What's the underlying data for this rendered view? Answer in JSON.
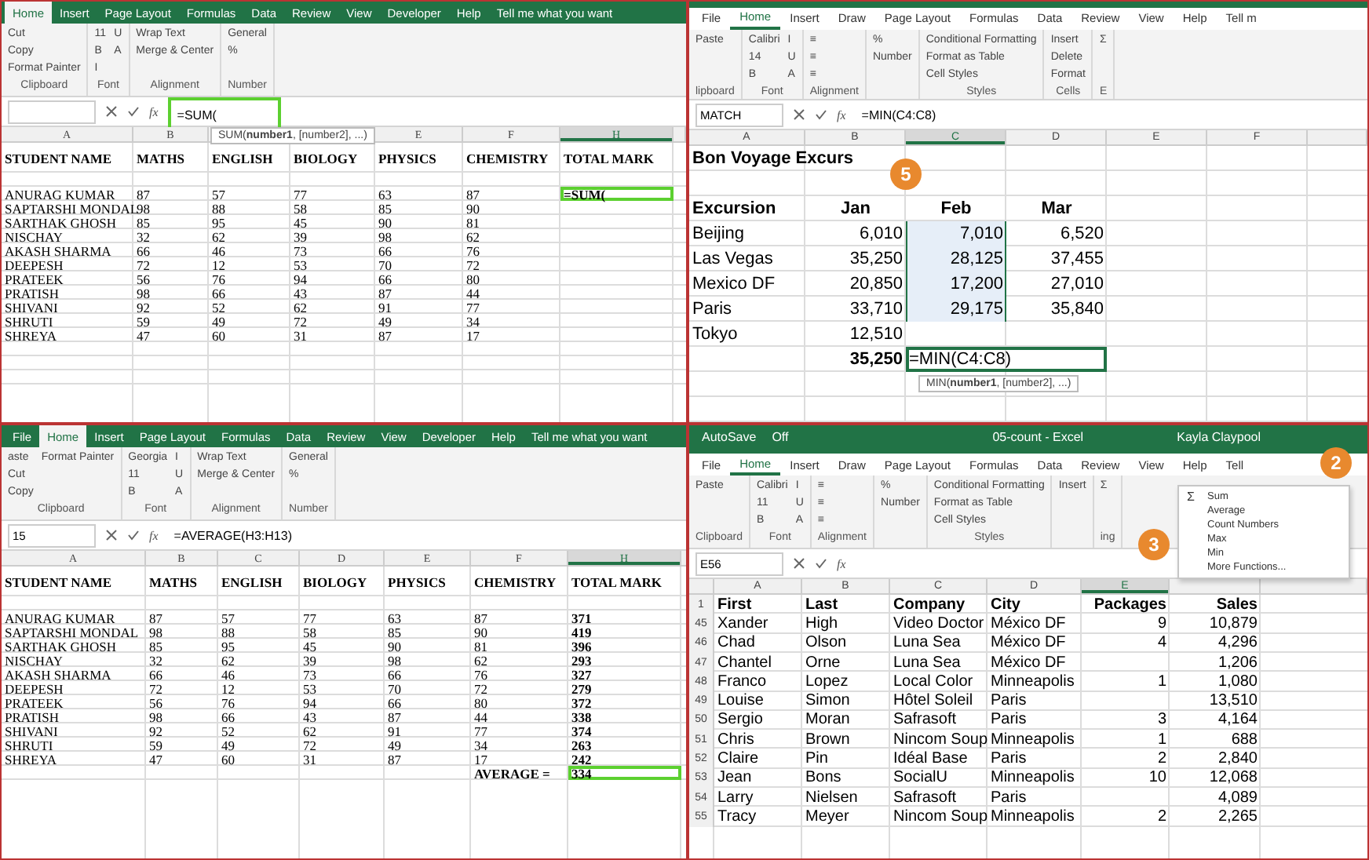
{
  "panels": [
    {
      "tabs": [
        {
          "label": "Home",
          "selected": true
        },
        {
          "label": "Insert",
          "selected": false
        },
        {
          "label": "Page Layout",
          "selected": false
        },
        {
          "label": "Formulas",
          "selected": false
        },
        {
          "label": "Data",
          "selected": false
        },
        {
          "label": "Review",
          "selected": false
        },
        {
          "label": "View",
          "selected": false
        },
        {
          "label": "Developer",
          "selected": false
        },
        {
          "label": "Help",
          "selected": false
        },
        {
          "label": "Tell me what you want",
          "selected": false
        }
      ],
      "ribbon": [
        {
          "label": "Clipboard",
          "items": [
            "Cut",
            "Copy",
            "Format Painter"
          ]
        },
        {
          "label": "Font",
          "items": [
            "11",
            "B",
            "I",
            "U",
            "A"
          ]
        },
        {
          "label": "Alignment",
          "items": [
            "Wrap Text",
            "Merge & Center"
          ]
        },
        {
          "label": "Number",
          "items": [
            "General",
            "%"
          ]
        }
      ],
      "fx": "fx",
      "formula": "=SUM(",
      "formula_outlined": true,
      "tooltip": "SUM(**number1**, [number2], ...)",
      "columns": [
        {
          "label": "A",
          "selected": false
        },
        {
          "label": "B",
          "selected": false
        },
        null,
        null,
        {
          "label": "E",
          "selected": false
        },
        {
          "label": "F",
          "selected": false
        },
        {
          "label": "H",
          "selected": true
        }
      ],
      "rows": [
        {
          "kind": "header",
          "cells": [
            "STUDENT NAME",
            "MATHS",
            "ENGLISH",
            "BIOLOGY",
            "PHYSICS",
            "CHEMISTRY",
            "TOTAL MARK"
          ]
        },
        {
          "kind": "blank"
        },
        {
          "kind": "data",
          "cells": [
            "ANURAG KUMAR",
            "87",
            "57",
            "77",
            "63",
            "87",
            {
              "text": "=SUM(",
              "selected": true,
              "kind": "label"
            }
          ]
        },
        {
          "kind": "data",
          "cells": [
            "SAPTARSHI MONDAL",
            "98",
            "88",
            "58",
            "85",
            "90"
          ]
        },
        {
          "kind": "data",
          "cells": [
            "SARTHAK GHOSH",
            "85",
            "95",
            "45",
            "90",
            "81"
          ]
        },
        {
          "kind": "data",
          "cells": [
            "NISCHAY",
            "32",
            "62",
            "39",
            "98",
            "62"
          ]
        },
        {
          "kind": "data",
          "cells": [
            "AKASH SHARMA",
            "66",
            "46",
            "73",
            "66",
            "76"
          ]
        },
        {
          "kind": "data",
          "cells": [
            "DEEPESH",
            "72",
            "12",
            "53",
            "70",
            "72"
          ]
        },
        {
          "kind": "data",
          "cells": [
            "PRATEEK",
            "56",
            "76",
            "94",
            "66",
            "80"
          ]
        },
        {
          "kind": "data",
          "cells": [
            "PRATISH",
            "98",
            "66",
            "43",
            "87",
            "44"
          ]
        },
        {
          "kind": "data",
          "cells": [
            "SHIVANI",
            "92",
            "52",
            "62",
            "91",
            "77"
          ]
        },
        {
          "kind": "data",
          "cells": [
            "SHRUTI",
            "59",
            "49",
            "72",
            "49",
            "34"
          ]
        },
        {
          "kind": "data",
          "cells": [
            "SHREYA",
            "47",
            "60",
            "31",
            "87",
            "17"
          ]
        }
      ]
    },
    {
      "tabs": [
        {
          "label": "File",
          "selected": false
        },
        {
          "label": "Home",
          "selected": true
        },
        {
          "label": "Insert",
          "selected": false
        },
        {
          "label": "Draw",
          "selected": false
        },
        {
          "label": "Page Layout",
          "selected": false
        },
        {
          "label": "Formulas",
          "selected": false
        },
        {
          "label": "Data",
          "selected": false
        },
        {
          "label": "Review",
          "selected": false
        },
        {
          "label": "View",
          "selected": false
        },
        {
          "label": "Help",
          "selected": false
        },
        {
          "label": "Tell m",
          "selected": false
        }
      ],
      "ribbon": [
        {
          "label": "lipboard",
          "items": [
            "Paste"
          ]
        },
        {
          "label": "Font",
          "items": [
            "Calibri",
            "14",
            "B",
            "I",
            "U",
            "A"
          ]
        },
        {
          "label": "Alignment",
          "items": [
            "≡",
            "≡",
            "≡"
          ]
        },
        {
          "items": [
            "%",
            "Number"
          ]
        },
        {
          "label": "Styles",
          "items": [
            "Conditional Formatting",
            "Format as Table",
            "Cell Styles"
          ]
        },
        {
          "label": "Cells",
          "items": [
            "Insert",
            "Delete",
            "Format"
          ]
        },
        {
          "label": "E",
          "items": [
            "Σ"
          ]
        }
      ],
      "name_box": "MATCH",
      "fx": "fx",
      "formula": "=MIN(C4:C8)",
      "formula_outlined": false,
      "tooltip": "MIN(**number1**, [number2], ...)",
      "callouts": [
        {
          "label": "5"
        }
      ],
      "columns": [
        {
          "label": "A",
          "selected": false
        },
        {
          "label": "B",
          "selected": false
        },
        {
          "label": "C",
          "selected": true
        },
        {
          "label": "D",
          "selected": false
        },
        {
          "label": "E",
          "selected": false
        },
        {
          "label": "F",
          "selected": false
        }
      ],
      "rows": [
        {
          "kind": "header",
          "cells": [
            "Bon Voyage Excurs"
          ]
        },
        {
          "kind": "blank"
        },
        {
          "kind": "header",
          "cells": [
            "Excursion",
            "Jan",
            "Feb",
            "Mar"
          ]
        },
        {
          "kind": "data",
          "cells": [
            "Beijing",
            "6,010",
            {
              "text": "7,010",
              "kind": "marquee"
            },
            "6,520"
          ]
        },
        {
          "kind": "data",
          "cells": [
            "Las Vegas",
            "35,250",
            {
              "text": "28,125",
              "kind": "marquee"
            },
            "37,455"
          ]
        },
        {
          "kind": "data",
          "cells": [
            "Mexico DF",
            "20,850",
            {
              "text": "17,200",
              "kind": "marquee"
            },
            "27,010"
          ]
        },
        {
          "kind": "data",
          "cells": [
            "Paris",
            "33,710",
            {
              "text": "29,175",
              "kind": "marquee"
            },
            "35,840"
          ]
        },
        {
          "kind": "data",
          "cells": [
            "Tokyo",
            "12,510"
          ]
        },
        {
          "kind": "data",
          "cells": [
            "",
            {
              "text": "35,250",
              "kind": "label"
            },
            {
              "text": "=MIN(C4:C8)",
              "selected": true
            }
          ]
        }
      ]
    },
    {
      "tabs": [
        {
          "label": "File",
          "selected": false
        },
        {
          "label": "Home",
          "selected": true
        },
        {
          "label": "Insert",
          "selected": false
        },
        {
          "label": "Page Layout",
          "selected": false
        },
        {
          "label": "Formulas",
          "selected": false
        },
        {
          "label": "Data",
          "selected": false
        },
        {
          "label": "Review",
          "selected": false
        },
        {
          "label": "View",
          "selected": false
        },
        {
          "label": "Developer",
          "selected": false
        },
        {
          "label": "Help",
          "selected": false
        },
        {
          "label": "Tell me what you want",
          "selected": false
        }
      ],
      "ribbon": [
        {
          "label": "Clipboard",
          "items": [
            "aste",
            "Cut",
            "Copy",
            "Format Painter"
          ]
        },
        {
          "label": "Font",
          "items": [
            "Georgia",
            "11",
            "B",
            "I",
            "U",
            "A"
          ]
        },
        {
          "label": "Alignment",
          "items": [
            "Wrap Text",
            "Merge & Center"
          ]
        },
        {
          "label": "Number",
          "items": [
            "General",
            "%"
          ]
        }
      ],
      "name_box": "15",
      "fx": "fx",
      "formula": "=AVERAGE(H3:H13)",
      "formula_outlined": false,
      "columns": [
        {
          "label": "A",
          "selected": false
        },
        {
          "label": "B",
          "selected": false
        },
        {
          "label": "C",
          "selected": false
        },
        {
          "label": "D",
          "selected": false
        },
        {
          "label": "E",
          "selected": false
        },
        {
          "label": "F",
          "selected": false
        },
        {
          "label": "H",
          "selected": true
        }
      ],
      "rows": [
        {
          "kind": "header",
          "cells": [
            "STUDENT NAME",
            "MATHS",
            "ENGLISH",
            "BIOLOGY",
            "PHYSICS",
            "CHEMISTRY",
            "TOTAL MARK"
          ]
        },
        {
          "kind": "blank"
        },
        {
          "kind": "data",
          "cells": [
            "ANURAG KUMAR",
            "87",
            "57",
            "77",
            "63",
            "87",
            {
              "text": "371",
              "kind": "label"
            }
          ]
        },
        {
          "kind": "data",
          "cells": [
            "SAPTARSHI MONDAL",
            "98",
            "88",
            "58",
            "85",
            "90",
            {
              "text": "419",
              "kind": "label"
            }
          ]
        },
        {
          "kind": "data",
          "cells": [
            "SARTHAK GHOSH",
            "85",
            "95",
            "45",
            "90",
            "81",
            {
              "text": "396",
              "kind": "label"
            }
          ]
        },
        {
          "kind": "data",
          "cells": [
            "NISCHAY",
            "32",
            "62",
            "39",
            "98",
            "62",
            {
              "text": "293",
              "kind": "label"
            }
          ]
        },
        {
          "kind": "data",
          "cells": [
            "AKASH SHARMA",
            "66",
            "46",
            "73",
            "66",
            "76",
            {
              "text": "327",
              "kind": "label"
            }
          ]
        },
        {
          "kind": "data",
          "cells": [
            "DEEPESH",
            "72",
            "12",
            "53",
            "70",
            "72",
            {
              "text": "279",
              "kind": "label"
            }
          ]
        },
        {
          "kind": "data",
          "cells": [
            "PRATEEK",
            "56",
            "76",
            "94",
            "66",
            "80",
            {
              "text": "372",
              "kind": "label"
            }
          ]
        },
        {
          "kind": "data",
          "cells": [
            "PRATISH",
            "98",
            "66",
            "43",
            "87",
            "44",
            {
              "text": "338",
              "kind": "label"
            }
          ]
        },
        {
          "kind": "data",
          "cells": [
            "SHIVANI",
            "92",
            "52",
            "62",
            "91",
            "77",
            {
              "text": "374",
              "kind": "label"
            }
          ]
        },
        {
          "kind": "data",
          "cells": [
            "SHRUTI",
            "59",
            "49",
            "72",
            "49",
            "34",
            {
              "text": "263",
              "kind": "label"
            }
          ]
        },
        {
          "kind": "data",
          "cells": [
            "SHREYA",
            "47",
            "60",
            "31",
            "87",
            "17",
            {
              "text": "242",
              "kind": "label"
            }
          ]
        },
        {
          "kind": "data",
          "cells": [
            "",
            "",
            "",
            "",
            "",
            {
              "text": "AVERAGE =",
              "kind": "label"
            },
            {
              "text": "334",
              "kind": "label",
              "selected": true
            }
          ]
        }
      ]
    },
    {
      "title_bar": {
        "autosave": "AutoSave",
        "autosave_state": "Off",
        "title": "05-count - Excel",
        "user": "Kayla Claypool"
      },
      "tabs": [
        {
          "label": "File",
          "selected": false
        },
        {
          "label": "Home",
          "selected": true
        },
        {
          "label": "Insert",
          "selected": false
        },
        {
          "label": "Draw",
          "selected": false
        },
        {
          "label": "Page Layout",
          "selected": false
        },
        {
          "label": "Formulas",
          "selected": false
        },
        {
          "label": "Data",
          "selected": false
        },
        {
          "label": "Review",
          "selected": false
        },
        {
          "label": "View",
          "selected": false
        },
        {
          "label": "Help",
          "selected": false
        },
        {
          "label": "Tell",
          "selected": false
        }
      ],
      "ribbon": [
        {
          "label": "Clipboard",
          "items": [
            "Paste"
          ]
        },
        {
          "label": "Font",
          "items": [
            "Calibri",
            "11",
            "B",
            "I",
            "U",
            "A"
          ]
        },
        {
          "label": "Alignment",
          "items": [
            "≡",
            "≡",
            "≡"
          ]
        },
        {
          "items": [
            "%",
            "Number"
          ]
        },
        {
          "label": "Styles",
          "items": [
            "Conditional Formatting",
            "Format as Table",
            "Cell Styles"
          ]
        },
        {
          "items": [
            "Insert"
          ]
        },
        {
          "label": "ing",
          "items": [
            "Σ"
          ]
        }
      ],
      "name_box": "E56",
      "fx": "fx",
      "menu": [
        {
          "icon": "Σ",
          "label": "Sum"
        },
        {
          "label": "Average"
        },
        {
          "label": "Count Numbers"
        },
        {
          "label": "Max"
        },
        {
          "label": "Min"
        },
        {
          "label": "More Functions..."
        }
      ],
      "callouts": [
        {
          "label": "2"
        },
        {
          "label": "3"
        }
      ],
      "columns": [
        {
          "label": "A",
          "selected": false
        },
        {
          "label": "B",
          "selected": false
        },
        {
          "label": "C",
          "selected": false
        },
        {
          "label": "D",
          "selected": false
        },
        {
          "label": "E",
          "selected": true
        },
        null
      ],
      "rows": [
        {
          "label": "1",
          "kind": "header",
          "cells": [
            "First",
            "Last",
            "Company",
            "City",
            "Packages",
            "Sales"
          ]
        },
        {
          "label": "45",
          "kind": "data",
          "cells": [
            "Xander",
            "High",
            "Video Doctor",
            "México DF",
            "9",
            "10,879"
          ]
        },
        {
          "label": "46",
          "kind": "data",
          "cells": [
            "Chad",
            "Olson",
            "Luna Sea",
            "México DF",
            "4",
            "4,296"
          ]
        },
        {
          "label": "47",
          "kind": "data",
          "cells": [
            "Chantel",
            "Orne",
            "Luna Sea",
            "México DF",
            "",
            "1,206"
          ]
        },
        {
          "label": "48",
          "kind": "data",
          "cells": [
            "Franco",
            "Lopez",
            "Local Color",
            "Minneapolis",
            "1",
            "1,080"
          ]
        },
        {
          "label": "49",
          "kind": "data",
          "cells": [
            "Louise",
            "Simon",
            "Hôtel Soleil",
            "Paris",
            "",
            "13,510"
          ]
        },
        {
          "label": "50",
          "kind": "data",
          "cells": [
            "Sergio",
            "Moran",
            "Safrasoft",
            "Paris",
            "3",
            "4,164"
          ]
        },
        {
          "label": "51",
          "kind": "data",
          "cells": [
            "Chris",
            "Brown",
            "Nincom Soup",
            "Minneapolis",
            "1",
            "688"
          ]
        },
        {
          "label": "52",
          "kind": "data",
          "cells": [
            "Claire",
            "Pin",
            "Idéal Base",
            "Paris",
            "2",
            "2,840"
          ]
        },
        {
          "label": "53",
          "kind": "data",
          "cells": [
            "Jean",
            "Bons",
            "SocialU",
            "Minneapolis",
            "10",
            "12,068"
          ]
        },
        {
          "label": "54",
          "kind": "data",
          "cells": [
            "Larry",
            "Nielsen",
            "Safrasoft",
            "Paris",
            "",
            "4,089"
          ]
        },
        {
          "label": "55",
          "kind": "data",
          "cells": [
            "Tracy",
            "Meyer",
            "Nincom Soup",
            "Minneapolis",
            "2",
            "2,265"
          ]
        }
      ]
    }
  ]
}
